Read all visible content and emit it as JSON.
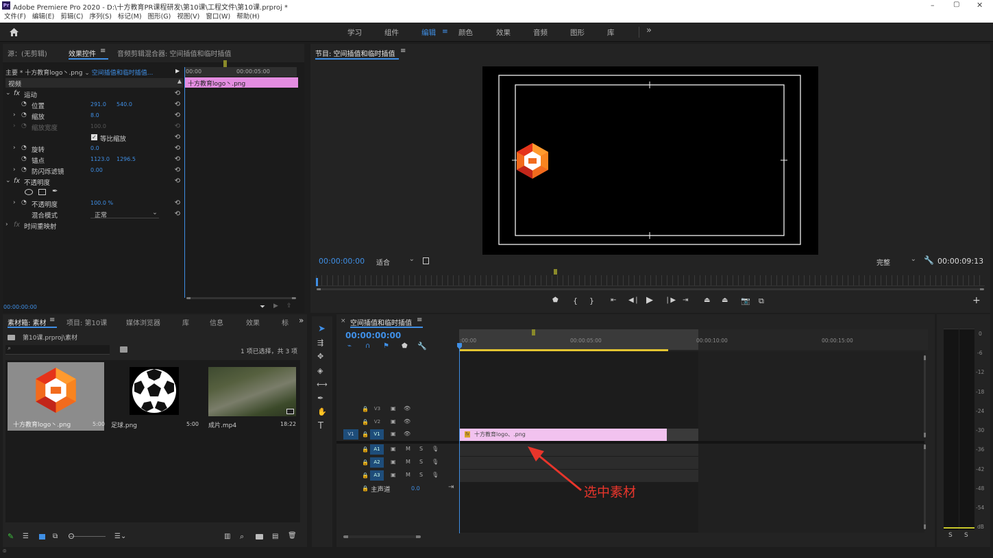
{
  "app": {
    "title": "Adobe Premiere Pro 2020 - D:\\十方教育PR课程研发\\第10课\\工程文件\\第10课.prproj *",
    "icon_label": "Pr",
    "window_controls": [
      "–",
      "▢",
      "✕"
    ]
  },
  "menu": [
    "文件(F)",
    "编辑(E)",
    "剪辑(C)",
    "序列(S)",
    "标记(M)",
    "图形(G)",
    "视图(V)",
    "窗口(W)",
    "帮助(H)"
  ],
  "workspaces": {
    "items": [
      "学习",
      "组件",
      "编辑",
      "颜色",
      "效果",
      "音频",
      "图形",
      "库"
    ],
    "active": "编辑",
    "more": "»"
  },
  "effect_controls": {
    "tabs": [
      "源：(无剪辑)",
      "效果控件",
      "音频剪辑混合器: 空间插值和临时插值"
    ],
    "clip_path_prefix": "主要 * 十方教育logo丶.png",
    "clip_path_seq": "空间插值和临时插值...",
    "ruler": [
      "00:00",
      "00:00:05:00"
    ],
    "clip_bar": "十方教育logo丶.png",
    "video_header": "视频",
    "motion": "运动",
    "props": [
      {
        "name": "位置",
        "v1": "291.0",
        "v2": "540.0"
      },
      {
        "name": "缩放",
        "v1": "8.0",
        "v2": ""
      },
      {
        "name": "缩放宽度",
        "v1": "100.0",
        "v2": ""
      },
      {
        "name": "等比缩放",
        "v1": "",
        "v2": ""
      },
      {
        "name": "旋转",
        "v1": "0.0",
        "v2": ""
      },
      {
        "name": "锚点",
        "v1": "1123.0",
        "v2": "1296.5"
      },
      {
        "name": "防闪烁滤镜",
        "v1": "0.00",
        "v2": ""
      }
    ],
    "opacity_group": "不透明度",
    "opacity": {
      "name": "不透明度",
      "value": "100.0 %"
    },
    "blend": {
      "name": "混合模式",
      "value": "正常"
    },
    "time_remap": "时间重映射",
    "timecode": "00:00:00:00"
  },
  "program": {
    "title": "节目: 空间插值和临时插值",
    "timecode": "00:00:00:00",
    "zoom": "适合",
    "quality": "完整",
    "duration": "00:00:09:13"
  },
  "project": {
    "tabs": [
      "素材箱: 素材",
      "项目: 第10课",
      "媒体浏览器",
      "库",
      "信息",
      "效果",
      "标"
    ],
    "more": "»",
    "bin_path": "第10课.prproj\\素材",
    "selection": "1 项已选择，共 3 项",
    "items": [
      {
        "name": "十方教育logo丶.png",
        "dur": "5:00"
      },
      {
        "name": "足球.png",
        "dur": "5:00"
      },
      {
        "name": "成片.mp4",
        "dur": "18:22"
      }
    ]
  },
  "timeline": {
    "title": "空间插值和临时插值",
    "timecode": "00:00:00:00",
    "ticks": [
      ":00:00",
      "00:00:05:00",
      "00:00:10:00",
      "00:00:15:00"
    ],
    "video_tracks": [
      "V3",
      "V2",
      "V1"
    ],
    "audio_tracks": [
      "A1",
      "A2",
      "A3"
    ],
    "src_patch_v": "V1",
    "master_label": "主声道",
    "master_value": "0.0",
    "clip_label": "十方教育logo、.png",
    "fx_badge": "fx",
    "annotation": "选中素材"
  },
  "meter": {
    "scale": [
      "0",
      "-6",
      "-12",
      "-18",
      "-24",
      "-30",
      "-36",
      "-42",
      "-48",
      "-54",
      "dB"
    ],
    "solo": [
      "S",
      "S"
    ]
  },
  "colors": {
    "accent": "#3f8fe6",
    "clip": "#f2c2ef",
    "clip_bar": "#e48de1",
    "arrow": "#e8352b"
  }
}
